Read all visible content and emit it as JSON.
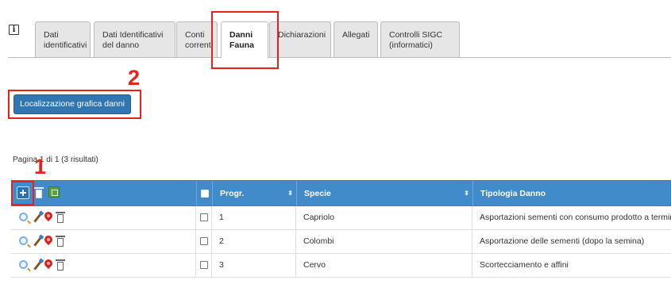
{
  "info": {
    "icon": "info-icon",
    "label": "i"
  },
  "tabs": [
    {
      "line1": "Dati",
      "line2": "identificativi",
      "active": false
    },
    {
      "line1": "Dati Identificativi",
      "line2": "del danno",
      "active": false
    },
    {
      "line1": "Conti",
      "line2": "correnti",
      "active": false
    },
    {
      "line1": "Danni",
      "line2": "Fauna",
      "active": true
    },
    {
      "line1": "Dichiarazioni",
      "line2": "",
      "active": false
    },
    {
      "line1": "Allegati",
      "line2": "",
      "active": false
    },
    {
      "line1": "Controlli SIGC",
      "line2": "(informatici)",
      "active": false
    }
  ],
  "annotations": {
    "one": "1",
    "two": "2"
  },
  "actions": {
    "map_button": "Localizzazione grafica danni"
  },
  "pagination": {
    "text": "Pagina 1 di 1 (3 risultati)"
  },
  "table": {
    "headers": {
      "progr": "Progr.",
      "specie": "Specie",
      "tipologia": "Tipologia Danno"
    },
    "rows": [
      {
        "progr": "1",
        "specie": "Capriolo",
        "tipologia": "Asportazioni sementi con consumo prodotto a termine"
      },
      {
        "progr": "2",
        "specie": "Colombi",
        "tipologia": "Asportazione delle sementi (dopo la semina)"
      },
      {
        "progr": "3",
        "specie": "Cervo",
        "tipologia": "Scortecciamento e affini"
      }
    ]
  },
  "colors": {
    "primary": "#3276b1",
    "header": "#428bca",
    "annotation": "#e8221b"
  }
}
